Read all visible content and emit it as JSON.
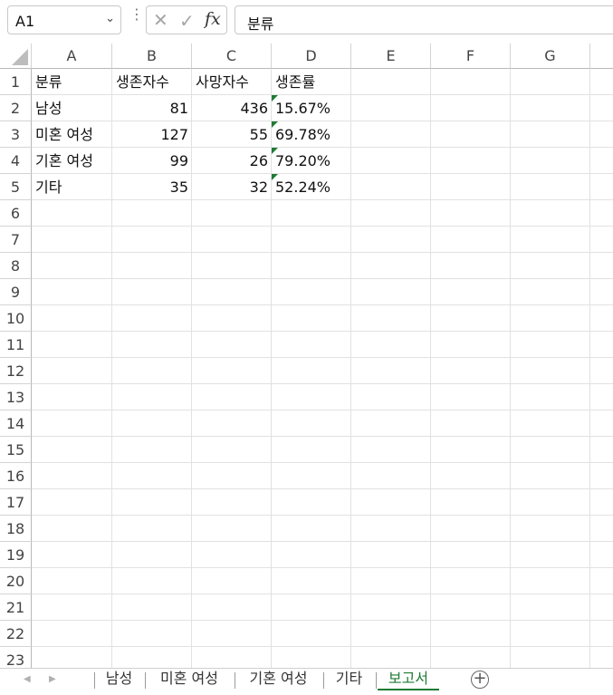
{
  "formula_bar": {
    "name_box": "A1",
    "formula": "분류"
  },
  "columns": [
    "A",
    "B",
    "C",
    "D",
    "E",
    "F",
    "G"
  ],
  "rows": [
    "1",
    "2",
    "3",
    "4",
    "5",
    "6",
    "7",
    "8",
    "9",
    "10",
    "11",
    "12",
    "13",
    "14",
    "15",
    "16",
    "17",
    "18",
    "19",
    "20",
    "21",
    "22",
    "23"
  ],
  "cells": {
    "A1": "분류",
    "B1": "생존자수",
    "C1": "사망자수",
    "D1": "생존률",
    "A2": "남성",
    "B2": "81",
    "C2": "436",
    "D2": "15.67%",
    "A3": "미혼 여성",
    "B3": "127",
    "C3": "55",
    "D3": "69.78%",
    "A4": "기혼 여성",
    "B4": "99",
    "C4": "26",
    "D4": "79.20%",
    "A5": "기타",
    "B5": "35",
    "C5": "32",
    "D5": "52.24%"
  },
  "sheet_tabs": [
    {
      "label": "남성",
      "active": false
    },
    {
      "label": "미혼 여성",
      "active": false
    },
    {
      "label": "기혼 여성",
      "active": false
    },
    {
      "label": "기타",
      "active": false
    },
    {
      "label": "보고서",
      "active": true
    }
  ],
  "colors": {
    "accent": "#1e7b34",
    "gridline": "#e1e1e1"
  }
}
